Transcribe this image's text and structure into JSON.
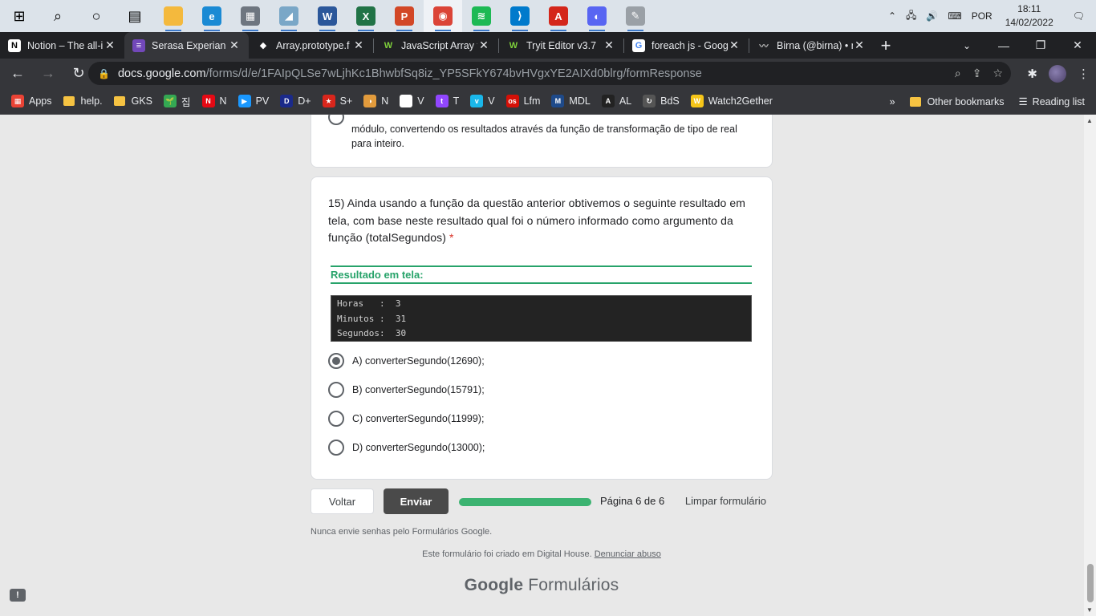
{
  "taskbar": {
    "apps": [
      {
        "name": "start",
        "glyph": "⊞",
        "color": "#000000"
      },
      {
        "name": "search",
        "glyph": "⌕",
        "color": "#000000"
      },
      {
        "name": "cortana",
        "glyph": "○",
        "color": "#000000"
      },
      {
        "name": "task-view",
        "glyph": "▤",
        "color": "#000000"
      },
      {
        "name": "file-explorer",
        "glyph": "",
        "color": "#f4b93d"
      },
      {
        "name": "edge",
        "glyph": "e",
        "color": "#1a8ad4"
      },
      {
        "name": "calculator",
        "glyph": "▦",
        "color": "#6e7680"
      },
      {
        "name": "notes",
        "glyph": "◢",
        "color": "#7aa7c7"
      },
      {
        "name": "word",
        "glyph": "W",
        "color": "#2b579a"
      },
      {
        "name": "excel",
        "glyph": "X",
        "color": "#217346"
      },
      {
        "name": "powerpoint",
        "glyph": "P",
        "color": "#d24726"
      },
      {
        "name": "chrome",
        "glyph": "◉",
        "color": "#db4437"
      },
      {
        "name": "spotify",
        "glyph": "≋",
        "color": "#1db954"
      },
      {
        "name": "vscode",
        "glyph": "⟩",
        "color": "#007acc"
      },
      {
        "name": "acrobat",
        "glyph": "A",
        "color": "#d4261a"
      },
      {
        "name": "discord",
        "glyph": "◐",
        "color": "#5865f2"
      },
      {
        "name": "paint",
        "glyph": "✎",
        "color": "#9aa0a6"
      }
    ],
    "language": "POR",
    "time": "18:11",
    "date": "14/02/2022"
  },
  "tabs": [
    {
      "title": "Notion – The all-i",
      "fav": "N",
      "favbg": "#ffffff",
      "favfg": "#000000",
      "active": false
    },
    {
      "title": "Serasa Experian T",
      "fav": "≡",
      "favbg": "#7248b9",
      "favfg": "#ffffff",
      "active": true
    },
    {
      "title": "Array.prototype.f",
      "fav": "◆",
      "favbg": "#202124",
      "favfg": "#ffffff",
      "active": false
    },
    {
      "title": "JavaScript Array f",
      "fav": "W",
      "favbg": "#202124",
      "favfg": "#7fd13b",
      "active": false
    },
    {
      "title": "Tryit Editor v3.7",
      "fav": "W",
      "favbg": "#202124",
      "favfg": "#7fd13b",
      "active": false
    },
    {
      "title": "foreach js - Goog",
      "fav": "G",
      "favbg": "#ffffff",
      "favfg": "#4285f4",
      "active": false
    },
    {
      "title": "Birna (@birna) • r",
      "fav": "〰",
      "favbg": "#202124",
      "favfg": "#bbbbbb",
      "active": false
    }
  ],
  "address": {
    "host": "docs.google.com",
    "path": "/forms/d/e/1FAIpQLSe7wLjhKc1BhwbfSq8iz_YP5SFkY674bvHVgxYE2AIXd0blrg/formResponse"
  },
  "bookmarks": [
    {
      "label": "Apps",
      "icon": "▦",
      "color": "#ea4335"
    },
    {
      "label": "help.",
      "icon": "folder",
      "color": "#f6c342"
    },
    {
      "label": "GKS",
      "icon": "folder",
      "color": "#f6c342"
    },
    {
      "label": "집",
      "icon": "🌱",
      "color": "#34a853"
    },
    {
      "label": "N",
      "icon": "N",
      "color": "#e50914"
    },
    {
      "label": "PV",
      "icon": "▶",
      "color": "#1a98ff"
    },
    {
      "label": "D+",
      "icon": "D",
      "color": "#1b2a8a"
    },
    {
      "label": "S+",
      "icon": "★",
      "color": "#d9261c"
    },
    {
      "label": "N",
      "icon": "◑",
      "color": "#e29b3c"
    },
    {
      "label": "V",
      "icon": "R",
      "color": "#ffffff"
    },
    {
      "label": "T",
      "icon": "t",
      "color": "#9146ff"
    },
    {
      "label": "V",
      "icon": "v",
      "color": "#1ab7ea"
    },
    {
      "label": "Lfm",
      "icon": "os",
      "color": "#d51007"
    },
    {
      "label": "MDL",
      "icon": "M",
      "color": "#1e4a8a"
    },
    {
      "label": "AL",
      "icon": "A",
      "color": "#222222"
    },
    {
      "label": "BdS",
      "icon": "↻",
      "color": "#555555"
    },
    {
      "label": "Watch2Gether",
      "icon": "W",
      "color": "#f5c518"
    }
  ],
  "bookmarks_right": {
    "more": "»",
    "other": "Other bookmarks",
    "reading": "Reading list"
  },
  "form": {
    "prev_option_text": "módulo, convertendo os resultados através da função de transformação de tipo de real para inteiro.",
    "question": "15) Ainda usando a função da questão anterior obtivemos o seguinte resultado em tela, com base neste resultado qual foi o número informado como argumento da função (totalSegundos)",
    "required_mark": "*",
    "result_heading": "Resultado em tela:",
    "terminal_lines": [
      "Horas   :  3",
      "Minutos :  31",
      "Segundos:  30"
    ],
    "options": [
      {
        "label": "A) converterSegundo(12690);",
        "selected": true
      },
      {
        "label": "B) converterSegundo(15791);",
        "selected": false
      },
      {
        "label": "C) converterSegundo(11999);",
        "selected": false
      },
      {
        "label": "D) converterSegundo(13000);",
        "selected": false
      }
    ],
    "back_label": "Voltar",
    "submit_label": "Enviar",
    "progress_fraction": 1.0,
    "page_indicator": "Página 6 de 6",
    "clear_label": "Limpar formulário",
    "password_note": "Nunca envie senhas pelo Formulários Google.",
    "created_text": "Este formulário foi criado em Digital House.",
    "report_abuse": "Denunciar abuso",
    "logo_google": "Google",
    "logo_forms": "Formulários",
    "feedback_icon": "!"
  },
  "colors": {
    "accent_green": "#27a36a",
    "progress": "#3cb371",
    "submit_bg": "#4a4a4a"
  }
}
